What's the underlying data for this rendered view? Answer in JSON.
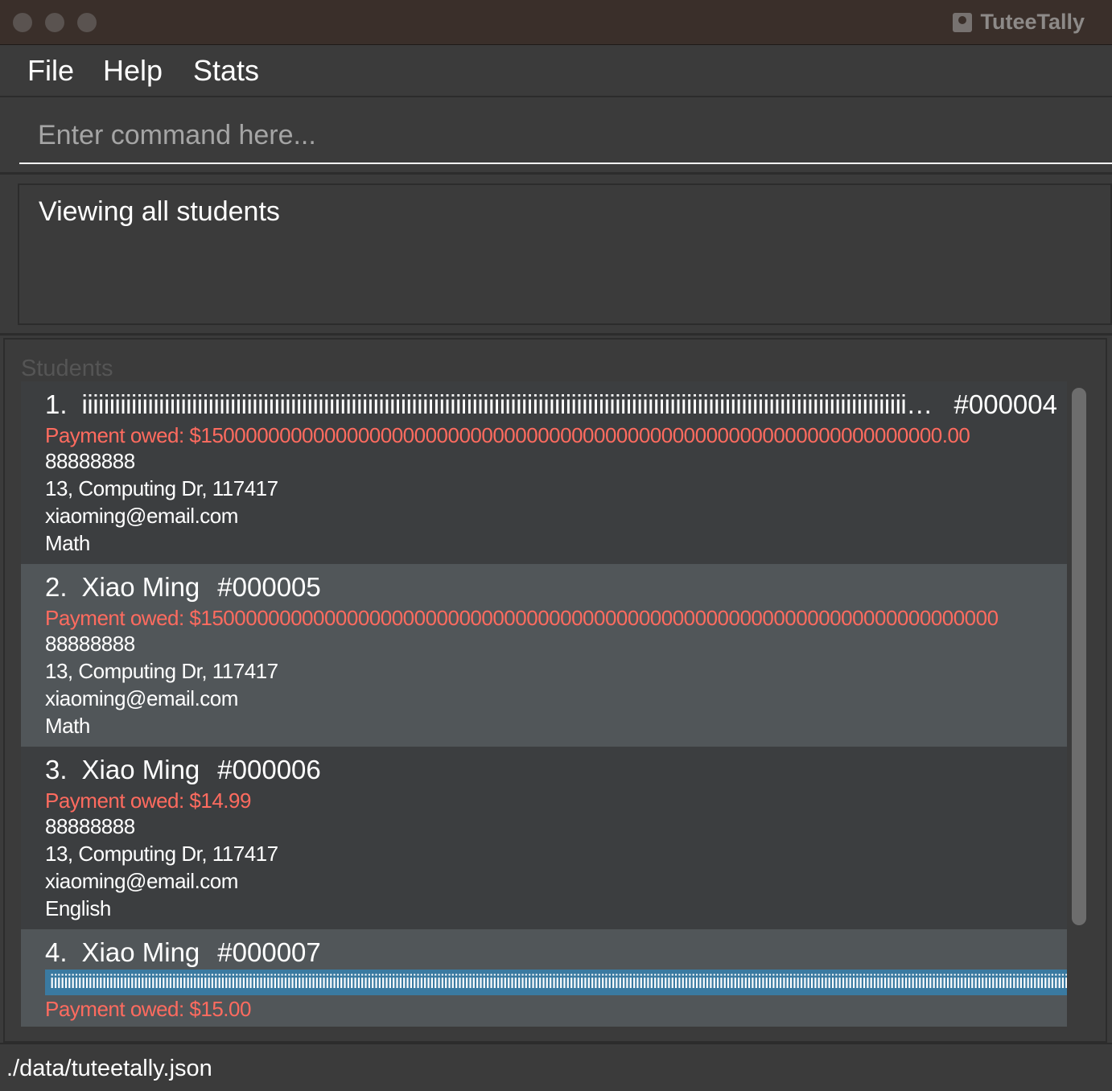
{
  "window": {
    "title": "TuteeTally"
  },
  "menu": {
    "file": "File",
    "help": "Help",
    "stats": "Stats"
  },
  "command": {
    "placeholder": "Enter command here...",
    "value": ""
  },
  "result": {
    "text": "Viewing all students"
  },
  "students_panel": {
    "title": "Students",
    "cards": [
      {
        "index": "1.",
        "name": "iiiiiiiiiiiiiiiiiiiiiiiiiiiiiiiiiiiiiiiiiiiiiiiiiiiiiiiiiiiiiiiiiiiiiiiiiiiiiiiiiiiiiiiiiiiiiiiiiiiiiiiiiiiiiiiiiiiiiiiiiiiiiiiiiiiiiiiiiiiiiiiiiiiiiiiiiiiiiiiiiiiiiiiiiiiiiiiiiiiiiiiiiiiiiiiiiiiiiiiiiiiiiiiiiiiiiiiiiiii",
        "id": "#000004",
        "payment": "Payment owed: $150000000000000000000000000000000000000000000000000000000000000000.00",
        "phone": "88888888",
        "address": "13, Computing Dr, 117417",
        "email": "xiaoming@email.com",
        "subject": "Math"
      },
      {
        "index": "2.",
        "name": "Xiao Ming",
        "id": "#000005",
        "payment": "Payment owed: $15000000000000000000000000000000000000000000000000000000000000000000000",
        "phone": "88888888",
        "address": "13, Computing Dr, 117417",
        "email": "xiaoming@email.com",
        "subject": "Math"
      },
      {
        "index": "3.",
        "name": "Xiao Ming",
        "id": "#000006",
        "payment": "Payment owed: $14.99",
        "phone": "88888888",
        "address": "13, Computing Dr, 117417",
        "email": "xiaoming@email.com",
        "subject": "English"
      },
      {
        "index": "4.",
        "name": "Xiao Ming",
        "id": "#000007",
        "tag": "iiiiiiiiiiiiiiiiiiiiiiiiiiiiiiiiiiiiiiiiiiiiiiiiiiiiiiiiiiiiiiiiiiiiiiiiiiiiiiiiiiiiiiiiiiiiiiiiiiiiiiiiiiiiiiiiiiiiiiiiiiiiiiiiiiiiiiiiiiiiiiiiiiiiiiiiiiiiiiiiiiiiiiiiiiiiiiiiiiiiiiiiiiiiiiiiiiiiiiiiiiiiiiiiiiiiiiiiiiiiiiiiiiiiiiiiiiiiiiiiiiiiiiiiiiiiiiiiiiiiiiiiiiiiiiiiiiiiiiiiiiiiiiiiiiiiiiiiiiiiiiiiiii",
        "payment": "Payment owed: $15.00"
      }
    ]
  },
  "status": {
    "path": "./data/tuteetally.json"
  },
  "colors": {
    "titlebar": "#3a2f2a",
    "background": "#3b3b3b",
    "payment_text": "#ff6b5f",
    "card_odd": "#3c3e40",
    "card_even": "#515659",
    "tag": "#3a7aa1"
  }
}
